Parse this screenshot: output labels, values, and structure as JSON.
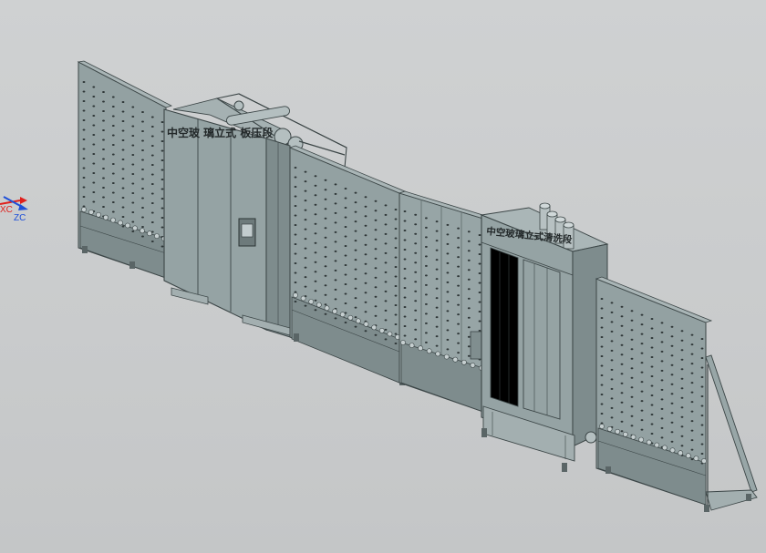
{
  "viewport": {
    "background": "#cbcdce",
    "machine_colors": {
      "panel": "#8f9d9e",
      "panel_dark": "#768485",
      "panel_light": "#a3b0b1",
      "edge": "#3c4647",
      "hole": "#2f3738"
    }
  },
  "triad": {
    "xc_label": "XC",
    "zc_label": "ZC",
    "x_color": "#e0201c",
    "z_color": "#1e4fd8"
  },
  "labels": {
    "press_section": "中空玻 璃立式 板压段",
    "wash_section": "中空玻璃立式清洗段"
  }
}
